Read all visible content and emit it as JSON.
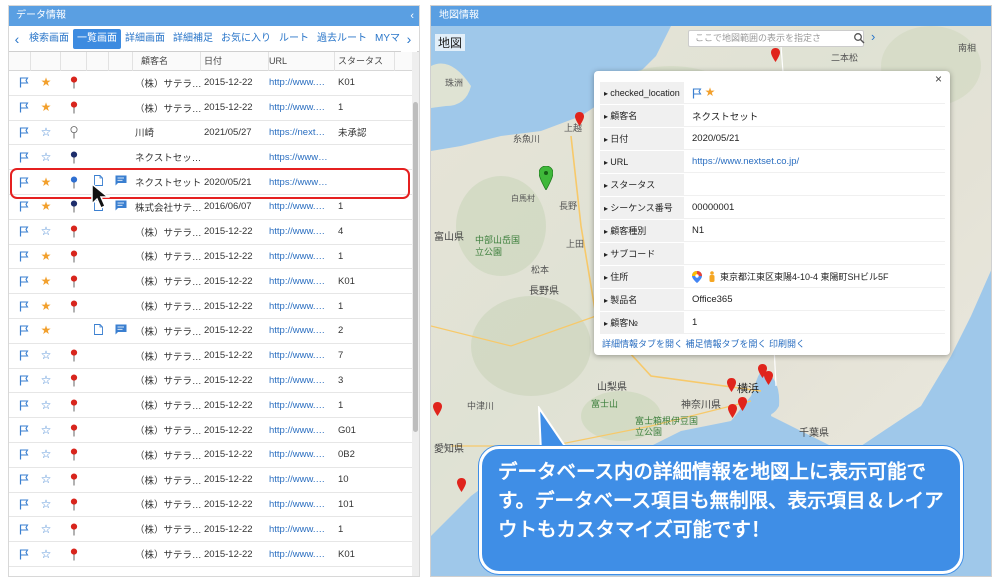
{
  "left_panel": {
    "title": "データ情報",
    "collapse_icon": "chevron-left-icon",
    "tabs": [
      {
        "label": "検索画面",
        "active": false
      },
      {
        "label": "一覧画面",
        "active": true
      },
      {
        "label": "詳細画面",
        "active": false
      },
      {
        "label": "詳細補足",
        "active": false
      },
      {
        "label": "お気に入り",
        "active": false
      },
      {
        "label": "ルート",
        "active": false
      },
      {
        "label": "過去ルート",
        "active": false
      },
      {
        "label": "MYマ",
        "active": false
      }
    ],
    "columns": {
      "name": "顧客名",
      "date": "日付",
      "url": "URL",
      "status": "スタータス"
    },
    "rows": [
      {
        "star": "on",
        "pin": "red",
        "doc": false,
        "note": false,
        "name": "（株）サテラ…",
        "date": "2015-12-22",
        "url": "http://www.…",
        "status": "K01"
      },
      {
        "star": "on",
        "pin": "red",
        "doc": false,
        "note": false,
        "name": "（株）サテラ…",
        "date": "2015-12-22",
        "url": "http://www.…",
        "status": "1"
      },
      {
        "star": "off",
        "pin": "outline",
        "doc": false,
        "note": false,
        "name": "川崎",
        "date": "2021/05/27",
        "url": "https://next…",
        "status": "未承認"
      },
      {
        "star": "off",
        "pin": "navy",
        "doc": false,
        "note": false,
        "name": "ネクストセッ…",
        "date": "",
        "url": "https://www…",
        "status": ""
      },
      {
        "star": "on",
        "pin": "blue",
        "doc": true,
        "note": true,
        "name": "ネクストセット",
        "date": "2020/05/21",
        "url": "https://www…",
        "status": ""
      },
      {
        "star": "on",
        "pin": "navy",
        "doc": true,
        "note": true,
        "name": "株式会社サテ…",
        "date": "2016/06/07",
        "url": "http://www.…",
        "status": "1"
      },
      {
        "star": "off",
        "pin": "red",
        "doc": false,
        "note": false,
        "name": "（株）サテラ…",
        "date": "2015-12-22",
        "url": "http://www.…",
        "status": "4"
      },
      {
        "star": "on",
        "pin": "red",
        "doc": false,
        "note": false,
        "name": "（株）サテラ…",
        "date": "2015-12-22",
        "url": "http://www.…",
        "status": "1"
      },
      {
        "star": "on",
        "pin": "red",
        "doc": false,
        "note": false,
        "name": "（株）サテラ…",
        "date": "2015-12-22",
        "url": "http://www.…",
        "status": "K01"
      },
      {
        "star": "on",
        "pin": "red",
        "doc": false,
        "note": false,
        "name": "（株）サテラ…",
        "date": "2015-12-22",
        "url": "http://www.…",
        "status": "1"
      },
      {
        "star": "on",
        "pin": "none",
        "doc": true,
        "note": true,
        "name": "（株）サテラ…",
        "date": "2015-12-22",
        "url": "http://www.…",
        "status": "2"
      },
      {
        "star": "off",
        "pin": "red",
        "doc": false,
        "note": false,
        "name": "（株）サテラ…",
        "date": "2015-12-22",
        "url": "http://www.…",
        "status": "7"
      },
      {
        "star": "off",
        "pin": "red",
        "doc": false,
        "note": false,
        "name": "（株）サテラ…",
        "date": "2015-12-22",
        "url": "http://www.…",
        "status": "3"
      },
      {
        "star": "off",
        "pin": "red",
        "doc": false,
        "note": false,
        "name": "（株）サテラ…",
        "date": "2015-12-22",
        "url": "http://www.…",
        "status": "1"
      },
      {
        "star": "off",
        "pin": "red",
        "doc": false,
        "note": false,
        "name": "（株）サテラ…",
        "date": "2015-12-22",
        "url": "http://www.…",
        "status": "G01"
      },
      {
        "star": "off",
        "pin": "red",
        "doc": false,
        "note": false,
        "name": "（株）サテラ…",
        "date": "2015-12-22",
        "url": "http://www.…",
        "status": "0B2"
      },
      {
        "star": "off",
        "pin": "red",
        "doc": false,
        "note": false,
        "name": "（株）サテラ…",
        "date": "2015-12-22",
        "url": "http://www.…",
        "status": "10"
      },
      {
        "star": "off",
        "pin": "red",
        "doc": false,
        "note": false,
        "name": "（株）サテラ…",
        "date": "2015-12-22",
        "url": "http://www.…",
        "status": "101"
      },
      {
        "star": "off",
        "pin": "red",
        "doc": false,
        "note": false,
        "name": "（株）サテラ…",
        "date": "2015-12-22",
        "url": "http://www.…",
        "status": "1"
      },
      {
        "star": "off",
        "pin": "red",
        "doc": false,
        "note": false,
        "name": "（株）サテラ…",
        "date": "2015-12-22",
        "url": "http://www.…",
        "status": "K01"
      }
    ]
  },
  "right_panel": {
    "title": "地図情報",
    "map_label": "地図",
    "search_placeholder": "ここで地図範囲の表示を指定さ",
    "map_places": [
      {
        "name": "珠洲",
        "type": "city"
      },
      {
        "name": "糸魚川",
        "type": "city"
      },
      {
        "name": "白馬村",
        "type": "city"
      },
      {
        "name": "中部山岳国立公園",
        "type": "park"
      },
      {
        "name": "富山県",
        "type": "pref"
      },
      {
        "name": "長野",
        "type": "city"
      },
      {
        "name": "上田",
        "type": "city"
      },
      {
        "name": "松本",
        "type": "city"
      },
      {
        "name": "長野県",
        "type": "pref"
      },
      {
        "name": "山梨県",
        "type": "pref"
      },
      {
        "name": "富士山",
        "type": "park"
      },
      {
        "name": "神奈川県",
        "type": "pref"
      },
      {
        "name": "横浜",
        "type": "city"
      },
      {
        "name": "千葉県",
        "type": "pref"
      },
      {
        "name": "富士箱根伊豆国立公園",
        "type": "park"
      },
      {
        "name": "中津川",
        "type": "city"
      },
      {
        "name": "愛知県",
        "type": "pref"
      },
      {
        "name": "南相",
        "type": "city"
      },
      {
        "name": "二本松",
        "type": "city"
      },
      {
        "name": "上越",
        "type": "city"
      }
    ],
    "popup": {
      "close": "×",
      "rows": [
        {
          "label": "checked_location",
          "value": "",
          "icons": true
        },
        {
          "label": "顧客名",
          "value": "ネクストセット"
        },
        {
          "label": "日付",
          "value": "2020/05/21"
        },
        {
          "label": "URL",
          "value": "https://www.nextset.co.jp/",
          "link": true
        },
        {
          "label": "スタータス",
          "value": ""
        },
        {
          "label": "シーケンス番号",
          "value": "00000001"
        },
        {
          "label": "顧客種別",
          "value": "N1"
        },
        {
          "label": "サブコード",
          "value": ""
        },
        {
          "label": "住所",
          "value": "東京都江東区東陽4-10-4 東陽町SHビル5F",
          "address_icons": true
        },
        {
          "label": "製品名",
          "value": "Office365"
        },
        {
          "label": "顧客№",
          "value": "1"
        }
      ],
      "links": "詳細情報タブを開く  補足情報タブを開く  印刷開く"
    },
    "callout": "データベース内の詳細情報を地図上に表示可能です。データベース項目も無制限、表示項目＆レイアウトもカスタマイズ可能です！"
  },
  "colors": {
    "header_blue": "#5a9fe2",
    "link_blue": "#2a6ec0",
    "star_orange": "#f2a02d",
    "highlight_red": "#e52020",
    "callout_blue": "#3f8ee6"
  }
}
